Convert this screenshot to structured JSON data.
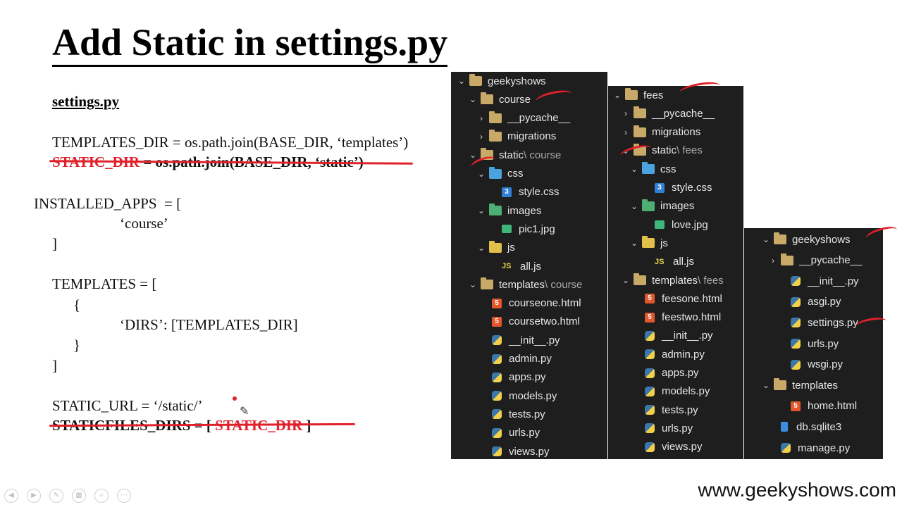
{
  "slide": {
    "title": "Add Static in settings.py",
    "subtitle": "settings.py",
    "templates_dir_line": "TEMPLATES_DIR = os.path.join(BASE_DIR, ‘templates’)",
    "static_dir_line_a": "STATIC_DIR",
    "static_dir_line_b": " = os.path.join(BASE_DIR, ‘static’)",
    "installed_apps_open": "INSTALLED_APPS  = [",
    "installed_apps_item": "‘course’",
    "installed_apps_close": "]",
    "templates_open": "TEMPLATES = [",
    "brace_open": "{",
    "dirs_line": "‘DIRS’: [TEMPLATES_DIR]",
    "brace_close": "}",
    "templates_close": "]",
    "static_url_line": "STATIC_URL = ‘/static/’",
    "staticfiles_a": "STATICFILES_DIRS = [ ",
    "staticfiles_b": "STATIC_DIR",
    "staticfiles_c": " ]",
    "footer": "www.geekyshows.com"
  },
  "tree1": [
    {
      "label": "geekyshows",
      "icon": "folder",
      "arrow": "v"
    },
    {
      "label": "course",
      "icon": "folder",
      "arrow": "v"
    },
    {
      "label": "__pycache__",
      "icon": "folder",
      "arrow": ">"
    },
    {
      "label": "migrations",
      "icon": "folder",
      "arrow": ">"
    },
    {
      "label": "static",
      "dim": " \\ course",
      "icon": "folder",
      "arrow": "v"
    },
    {
      "label": "css",
      "icon": "folder-blue",
      "arrow": "v"
    },
    {
      "label": "style.css",
      "icon": "css"
    },
    {
      "label": "images",
      "icon": "folder-green",
      "arrow": "v"
    },
    {
      "label": "pic1.jpg",
      "icon": "image"
    },
    {
      "label": "js",
      "icon": "folder-yellow",
      "arrow": "v"
    },
    {
      "label": "all.js",
      "icon": "js"
    },
    {
      "label": "templates",
      "dim": " \\ course",
      "icon": "folder",
      "arrow": "v"
    },
    {
      "label": "courseone.html",
      "icon": "html"
    },
    {
      "label": "coursetwo.html",
      "icon": "html"
    },
    {
      "label": "__init__.py",
      "icon": "python"
    },
    {
      "label": "admin.py",
      "icon": "python"
    },
    {
      "label": "apps.py",
      "icon": "python"
    },
    {
      "label": "models.py",
      "icon": "python"
    },
    {
      "label": "tests.py",
      "icon": "python"
    },
    {
      "label": "urls.py",
      "icon": "python"
    },
    {
      "label": "views.py",
      "icon": "python"
    }
  ],
  "tree2": [
    {
      "label": "fees",
      "icon": "folder",
      "arrow": "v"
    },
    {
      "label": "__pycache__",
      "icon": "folder",
      "arrow": ">"
    },
    {
      "label": "migrations",
      "icon": "folder",
      "arrow": ">"
    },
    {
      "label": "static",
      "dim": " \\ fees",
      "icon": "folder",
      "arrow": "v"
    },
    {
      "label": "css",
      "icon": "folder-blue",
      "arrow": "v"
    },
    {
      "label": "style.css",
      "icon": "css"
    },
    {
      "label": "images",
      "icon": "folder-green",
      "arrow": "v"
    },
    {
      "label": "love.jpg",
      "icon": "image"
    },
    {
      "label": "js",
      "icon": "folder-yellow",
      "arrow": "v"
    },
    {
      "label": "all.js",
      "icon": "js"
    },
    {
      "label": "templates",
      "dim": " \\ fees",
      "icon": "folder",
      "arrow": "v"
    },
    {
      "label": "feesone.html",
      "icon": "html"
    },
    {
      "label": "feestwo.html",
      "icon": "html"
    },
    {
      "label": "__init__.py",
      "icon": "python"
    },
    {
      "label": "admin.py",
      "icon": "python"
    },
    {
      "label": "apps.py",
      "icon": "python"
    },
    {
      "label": "models.py",
      "icon": "python"
    },
    {
      "label": "tests.py",
      "icon": "python"
    },
    {
      "label": "urls.py",
      "icon": "python"
    },
    {
      "label": "views.py",
      "icon": "python"
    }
  ],
  "tree3": [
    {
      "label": "geekyshows",
      "icon": "folder",
      "arrow": "v"
    },
    {
      "label": "__pycache__",
      "icon": "folder",
      "arrow": ">"
    },
    {
      "label": "__init__.py",
      "icon": "python"
    },
    {
      "label": "asgi.py",
      "icon": "python"
    },
    {
      "label": "settings.py",
      "icon": "python"
    },
    {
      "label": "urls.py",
      "icon": "python"
    },
    {
      "label": "wsgi.py",
      "icon": "python"
    },
    {
      "label": "templates",
      "icon": "folder",
      "arrow": "v"
    },
    {
      "label": "home.html",
      "icon": "html"
    },
    {
      "label": "db.sqlite3",
      "icon": "database"
    },
    {
      "label": "manage.py",
      "icon": "python"
    }
  ],
  "colors": {
    "accent": "#e0202a",
    "panel": "#1e1e1e"
  }
}
